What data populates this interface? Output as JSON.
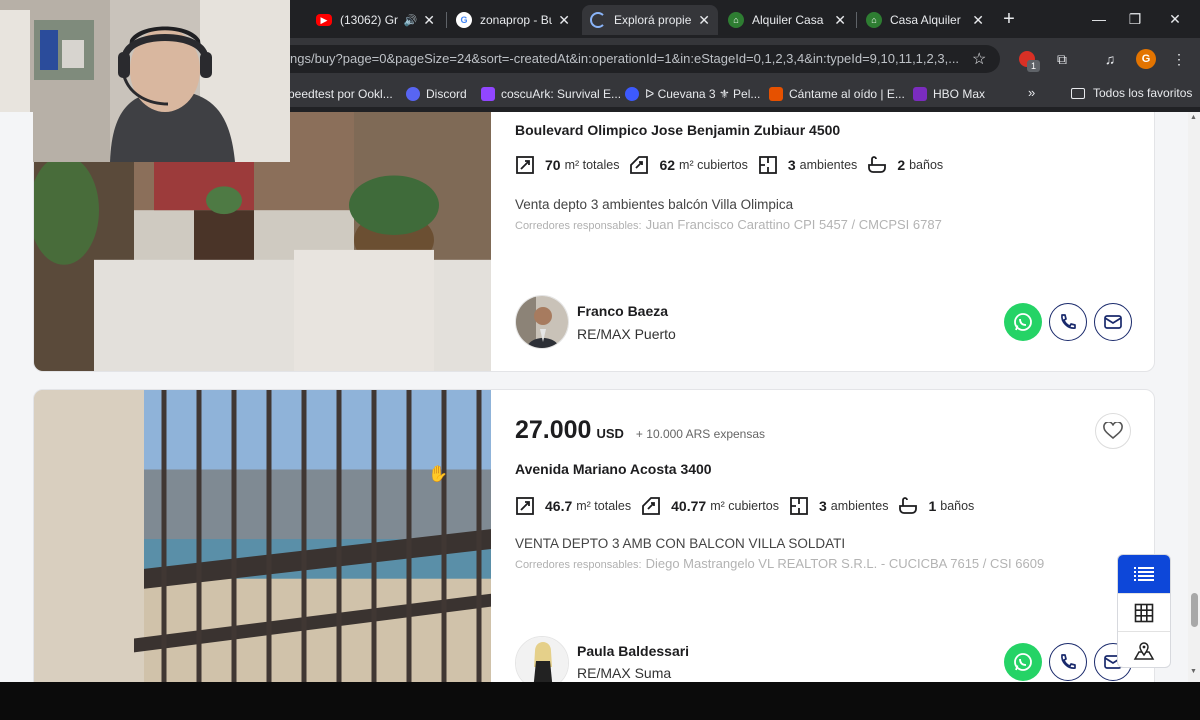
{
  "browser": {
    "tabs": [
      {
        "title": "(13062) Gr",
        "icon": "youtube-icon",
        "color": "#ff0000",
        "has_audio": true
      },
      {
        "title": "zonaprop - Bu",
        "icon": "google-icon",
        "color": "#4285f4"
      },
      {
        "title": "Explorá propie",
        "icon": "loading-icon",
        "color": "#8ab4f8",
        "active": true
      },
      {
        "title": "Alquiler Casa",
        "icon": "zonaprop-icon",
        "color": "#2e7d32"
      },
      {
        "title": "Casa Alquiler",
        "icon": "zonaprop-icon",
        "color": "#2e7d32"
      }
    ],
    "url": "ngs/buy?page=0&pageSize=24&sort=-createdAt&in:operationId=1&in:eStageId=0,1,2,3,4&in:typeId=9,10,11,1,2,3,...",
    "extension_badge": "1",
    "profile_initial": "G",
    "bookmarks": [
      {
        "label": "peedtest por Ookl...",
        "color": "#141526"
      },
      {
        "label": "Discord",
        "color": "#5865f2"
      },
      {
        "label": "coscuArk: Survival E...",
        "color": "#9146ff"
      },
      {
        "label": "ᐅ Cuevana 3 ⚜ Pel...",
        "color": "#3d5afe"
      },
      {
        "label": "Cántame al oído | E...",
        "color": "#e65100"
      },
      {
        "label": "HBO Max",
        "color": "#7b2cbf"
      }
    ],
    "bookmarks_folder": "Todos los favoritos"
  },
  "listings": [
    {
      "address": "Boulevard Olimpico Jose Benjamin Zubiaur 4500",
      "features": [
        {
          "icon": "total-area-icon",
          "value": "70",
          "unit": "m² totales"
        },
        {
          "icon": "covered-area-icon",
          "value": "62",
          "unit": "m² cubiertos"
        },
        {
          "icon": "rooms-icon",
          "value": "3",
          "unit": "ambientes"
        },
        {
          "icon": "bath-icon",
          "value": "2",
          "unit": "baños"
        }
      ],
      "description": "Venta depto 3 ambientes balcón Villa Olimpica",
      "brokers_label": "Corredores responsables:",
      "brokers": "Juan Francisco Carattino CPI 5457 / CMCPSI 6787",
      "agent_name": "Franco Baeza",
      "agency": "RE/MAX Puerto"
    },
    {
      "price": "27.000",
      "currency": "USD",
      "expenses": "+ 10.000 ARS expensas",
      "address": "Avenida Mariano Acosta 3400",
      "features": [
        {
          "icon": "total-area-icon",
          "value": "46.7",
          "unit": "m² totales"
        },
        {
          "icon": "covered-area-icon",
          "value": "40.77",
          "unit": "m² cubiertos"
        },
        {
          "icon": "rooms-icon",
          "value": "3",
          "unit": "ambientes"
        },
        {
          "icon": "bath-icon",
          "value": "1",
          "unit": "baños"
        }
      ],
      "description": "VENTA DEPTO 3 AMB CON BALCON VILLA SOLDATI",
      "brokers_label": "Corredores responsables:",
      "brokers": "Diego Mastrangelo VL REALTOR S.R.L. - CUCICBA 7615 / CSI 6609",
      "agent_name": "Paula Baldessari",
      "agency": "RE/MAX Suma"
    }
  ],
  "view_switcher": [
    {
      "icon": "list-view-icon",
      "active": true
    },
    {
      "icon": "grid-view-icon",
      "active": false
    },
    {
      "icon": "map-view-icon",
      "active": false
    }
  ],
  "colors": {
    "whatsapp": "#25d366",
    "brand_blue": "#0d47d9",
    "navy": "#1a2a6c"
  }
}
